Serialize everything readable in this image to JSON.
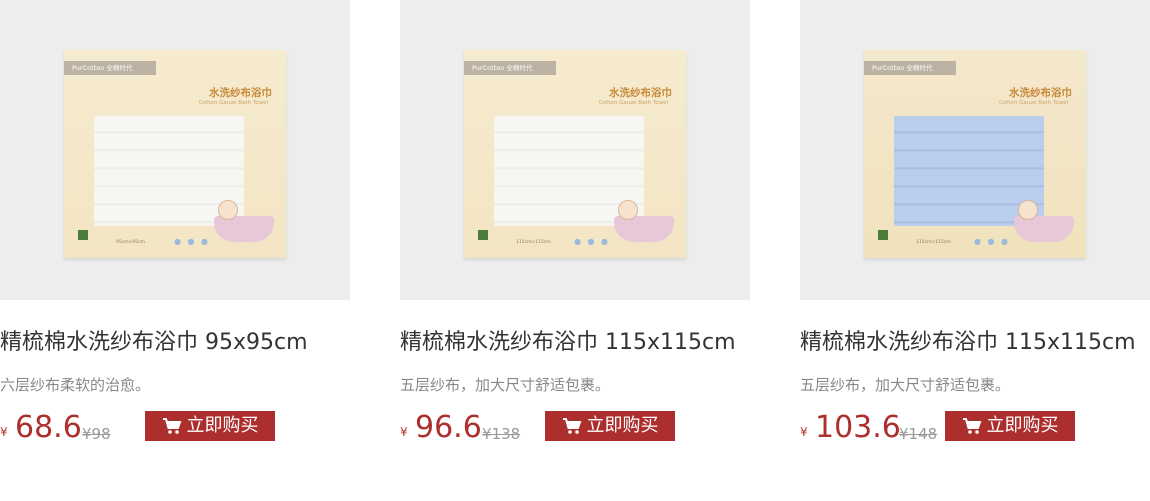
{
  "products": [
    {
      "title": "精梳棉水洗纱布浴巾 95x95cm",
      "description": "六层纱布柔软的治愈。",
      "currency": "¥",
      "price": "68.6",
      "old_price": "¥98",
      "buy_label": "立即购买",
      "box": {
        "brand": "PurCotton 全棉时代",
        "title": "水洗纱布浴巾",
        "subtitle": "Cotton Gauze Bath Towel",
        "size": "95cm×95cm",
        "towel_color": "#f7f6f2"
      }
    },
    {
      "title": "精梳棉水洗纱布浴巾 115x115cm",
      "description": "五层纱布，加大尺寸舒适包裹。",
      "currency": "¥",
      "price": "96.6",
      "old_price": "¥138",
      "buy_label": "立即购买",
      "box": {
        "brand": "PurCotton 全棉时代",
        "title": "水洗纱布浴巾",
        "subtitle": "Cotton Gauze Bath Towel",
        "size": "115cm×115cm",
        "towel_color": "#f7f6f2"
      }
    },
    {
      "title": "精梳棉水洗纱布浴巾 115x115cm",
      "description": "五层纱布，加大尺寸舒适包裹。",
      "currency": "¥",
      "price": "103.6",
      "old_price": "¥148",
      "buy_label": "立即购买",
      "box": {
        "brand": "PurCotton 全棉时代",
        "title": "水洗纱布浴巾",
        "subtitle": "Cotton Gauze Bath Towel",
        "size": "115cm×115cm",
        "towel_color": "#b9cdec"
      }
    }
  ],
  "colors": {
    "accent": "#ad2f2d",
    "title_text": "#333333",
    "desc_text": "#888888",
    "old_price_text": "#999999",
    "thumb_bg": "#ededed"
  },
  "icons": {
    "buy_button_icon": "cart-icon"
  }
}
